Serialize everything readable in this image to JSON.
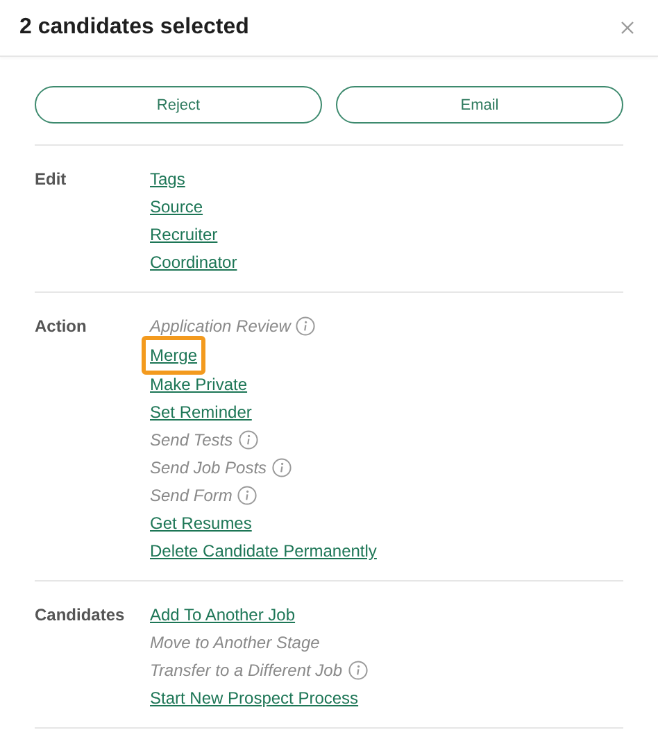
{
  "title": "2 candidates selected",
  "buttons": [
    "Reject",
    "Email"
  ],
  "sections": [
    {
      "label": "Edit",
      "items": [
        {
          "text": "Tags",
          "kind": "link",
          "info": false,
          "highlighted": false
        },
        {
          "text": "Source",
          "kind": "link",
          "info": false,
          "highlighted": false
        },
        {
          "text": "Recruiter",
          "kind": "link",
          "info": false,
          "highlighted": false
        },
        {
          "text": "Coordinator",
          "kind": "link",
          "info": false,
          "highlighted": false
        }
      ]
    },
    {
      "label": "Action",
      "items": [
        {
          "text": "Application Review",
          "kind": "disabled",
          "info": true,
          "highlighted": false
        },
        {
          "text": "Merge",
          "kind": "link",
          "info": false,
          "highlighted": true
        },
        {
          "text": "Make Private",
          "kind": "link",
          "info": false,
          "highlighted": false
        },
        {
          "text": "Set Reminder",
          "kind": "link",
          "info": false,
          "highlighted": false
        },
        {
          "text": "Send Tests",
          "kind": "disabled",
          "info": true,
          "highlighted": false
        },
        {
          "text": "Send Job Posts",
          "kind": "disabled",
          "info": true,
          "highlighted": false
        },
        {
          "text": "Send Form",
          "kind": "disabled",
          "info": true,
          "highlighted": false
        },
        {
          "text": "Get Resumes",
          "kind": "link",
          "info": false,
          "highlighted": false
        },
        {
          "text": "Delete Candidate Permanently",
          "kind": "link",
          "info": false,
          "highlighted": false
        }
      ]
    },
    {
      "label": "Candidates",
      "items": [
        {
          "text": "Add To Another Job",
          "kind": "link",
          "info": false,
          "highlighted": false
        },
        {
          "text": "Move to Another Stage",
          "kind": "disabled",
          "info": false,
          "highlighted": false
        },
        {
          "text": "Transfer to a Different Job",
          "kind": "disabled",
          "info": true,
          "highlighted": false
        },
        {
          "text": "Start New Prospect Process",
          "kind": "link",
          "info": false,
          "highlighted": false
        }
      ]
    }
  ]
}
